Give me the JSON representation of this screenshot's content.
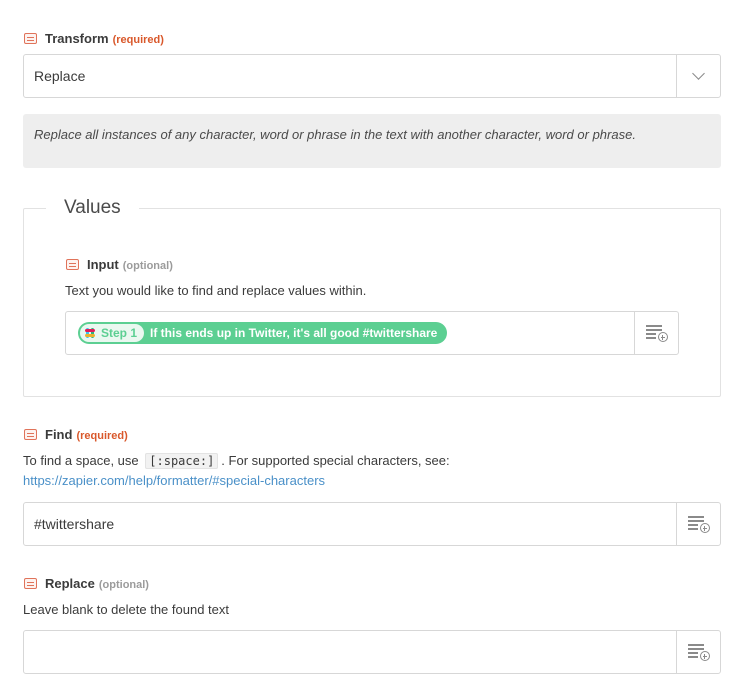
{
  "transform": {
    "label": "Transform",
    "required": "(required)",
    "value": "Replace",
    "description": "Replace all instances of any character, word or phrase in the text with another character, word or phrase."
  },
  "values": {
    "title": "Values",
    "input": {
      "label": "Input",
      "optional": "(optional)",
      "help": "Text you would like to find and replace values within.",
      "pill_step": "Step 1",
      "pill_text": "If this ends up in Twitter, it's all good #twittershare"
    }
  },
  "find": {
    "label": "Find",
    "required": "(required)",
    "help_prefix": "To find a space, use",
    "help_code": "[:space:]",
    "help_suffix": ". For supported special characters, see:",
    "link": "https://zapier.com/help/formatter/#special-characters",
    "value": "#twittershare"
  },
  "replace": {
    "label": "Replace",
    "optional": "(optional)",
    "help": "Leave blank to delete the found text",
    "value": ""
  },
  "icons": {
    "field": "field-type-icon",
    "dropdown": "chevron-down-icon",
    "insert": "insert-data-icon",
    "app": "slack-icon"
  },
  "colors": {
    "required": "#d9582b",
    "pill": "#5ccf92",
    "link": "#4a90c8"
  }
}
